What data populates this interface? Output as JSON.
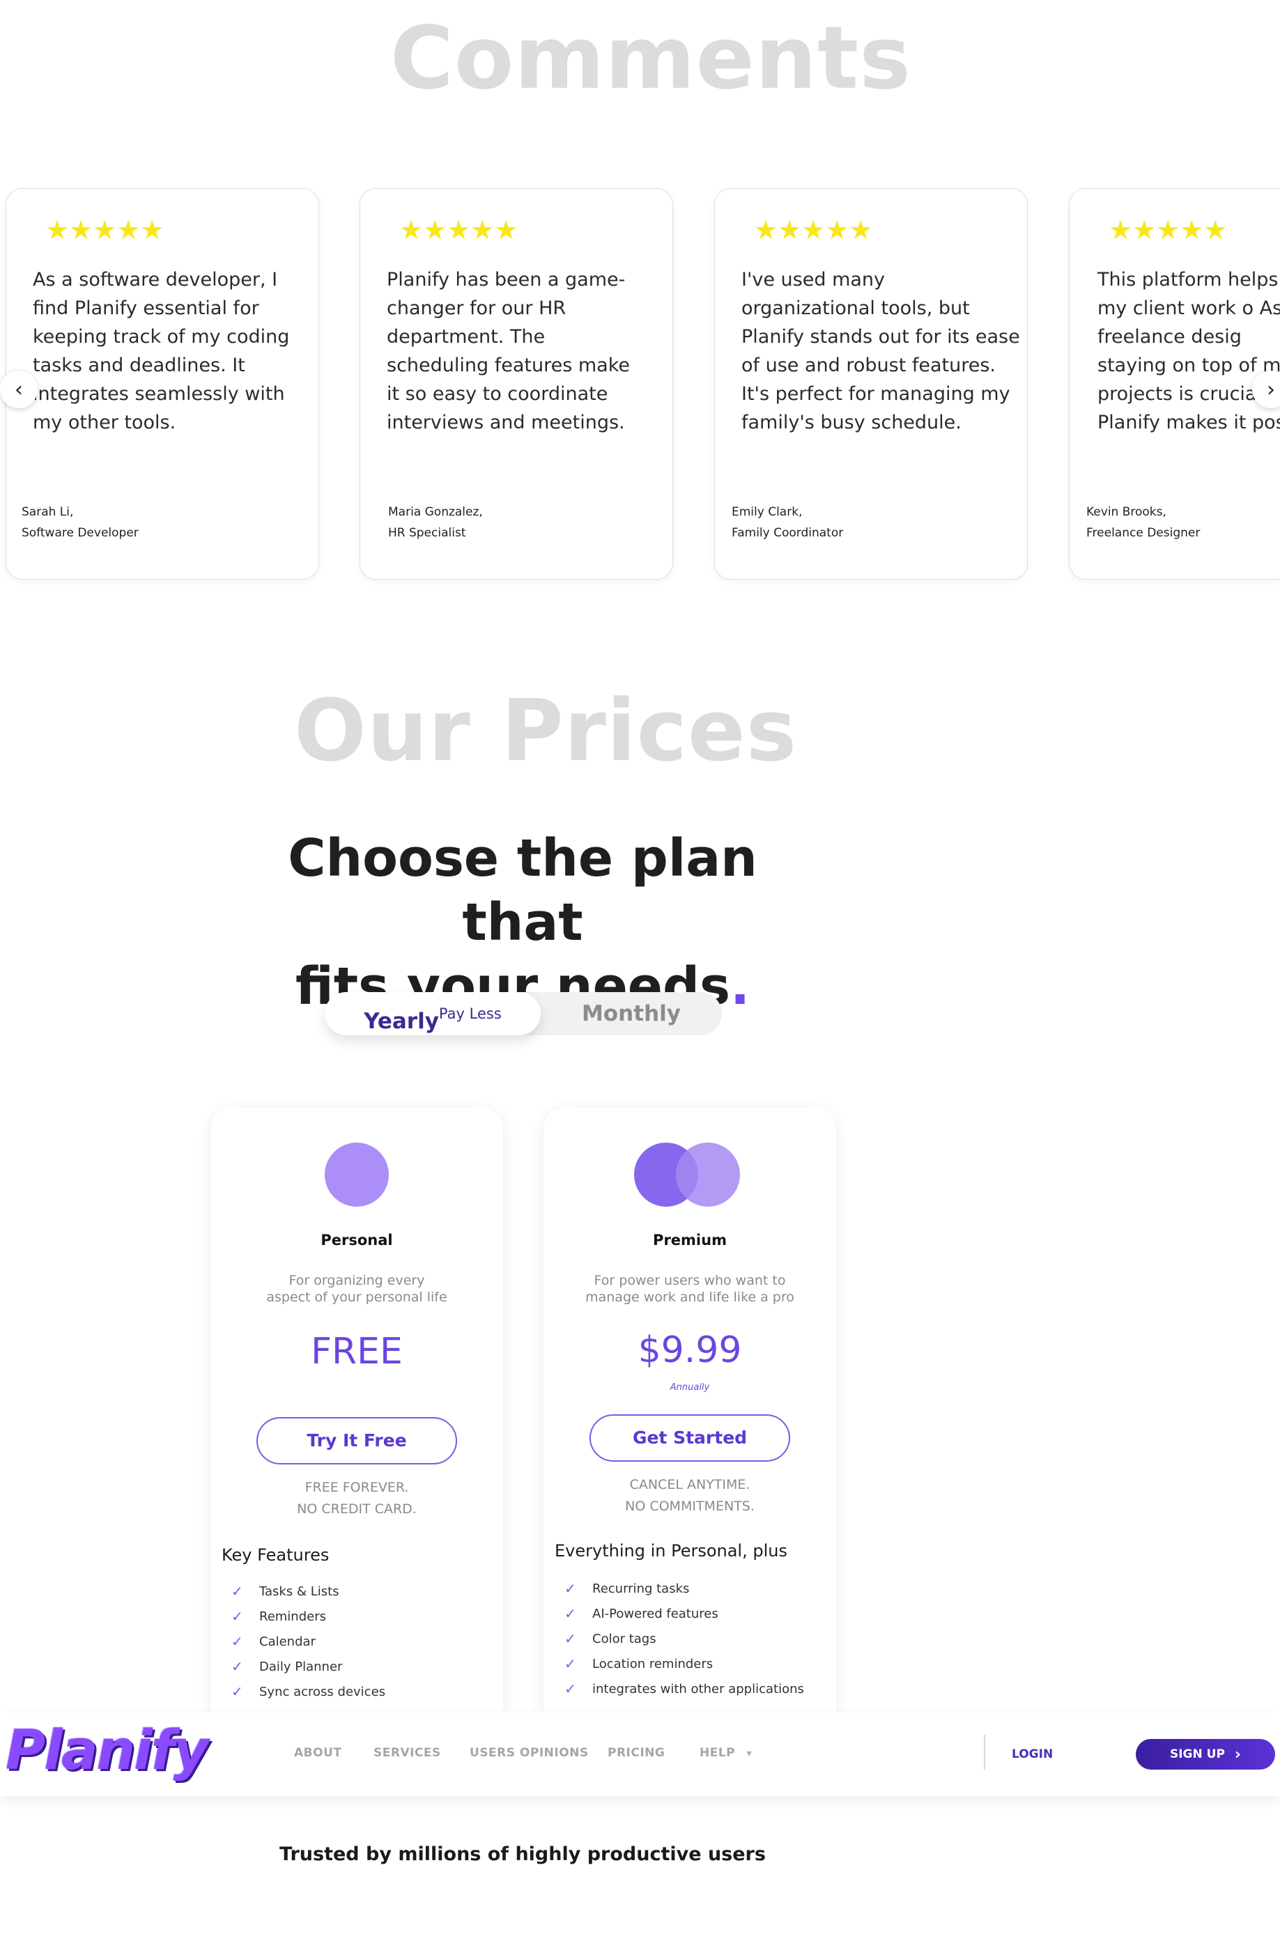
{
  "sections": {
    "comments_title": "Comments",
    "prices_title": "Our Prices"
  },
  "testimonials": [
    {
      "stars": "★★★★★",
      "quote": "As a software developer, I find Planify essential for keeping track of my coding tasks and deadlines. It integrates seamlessly with my other tools.",
      "name": "Sarah Li,",
      "role": "Software Developer"
    },
    {
      "stars": "★★★★★",
      "quote": "Planify has been a game-changer for our HR department. The scheduling features make it so easy to coordinate interviews and meetings.",
      "name": "Maria Gonzalez,",
      "role": "HR Specialist"
    },
    {
      "stars": "★★★★★",
      "quote": "I've used many organizational tools, but Planify stands out for its ease of use and robust features. It's perfect for managing my family's busy schedule.",
      "name": "Emily Clark,",
      "role": "Family Coordinator"
    },
    {
      "stars": "★★★★★",
      "quote": "This platform helps all my client work o As a freelance desig staying on top of m projects is crucia Planify makes it pos",
      "name": "Kevin Brooks,",
      "role": "Freelance Designer"
    }
  ],
  "carousel": {
    "prev_icon": "‹",
    "next_icon": "›"
  },
  "pricing": {
    "heading_line1": "Choose the plan that",
    "heading_line2": "fits your needs",
    "heading_dot": ".",
    "toggle": {
      "yearly": "Yearly",
      "yearly_badge": "Pay Less",
      "monthly": "Monthly",
      "selected": "Yearly"
    },
    "plans": [
      {
        "name": "Personal",
        "desc_line1": "For organizing every",
        "desc_line2": "aspect of your personal life",
        "price": "FREE",
        "period": "",
        "button": "Try It Free",
        "note_line1": "FREE FOREVER.",
        "note_line2": "NO CREDIT CARD.",
        "features_title": "Key Features",
        "features": [
          "Tasks & Lists",
          "Reminders",
          "Calendar",
          "Daily Planner",
          "Sync across devices"
        ]
      },
      {
        "name": "Premium",
        "desc_line1": "For power users who want to",
        "desc_line2": "manage work and life like a pro",
        "price": "$9.99",
        "period": "Annually",
        "button": "Get Started",
        "note_line1": "CANCEL ANYTIME.",
        "note_line2": "NO COMMITMENTS.",
        "features_title": "Everything in Personal, plus",
        "features": [
          "Recurring tasks",
          "AI-Powered features",
          "Color tags",
          "Location reminders",
          "integrates with other applications"
        ]
      }
    ],
    "check_icon": "✓"
  },
  "navbar": {
    "brand": "Planify",
    "links": [
      "ABOUT",
      "SERVICES",
      "USERS OPINIONS",
      "PRICING",
      "HELP"
    ],
    "help_caret": "▾",
    "login": "LOGIN",
    "signup": "SIGN UP",
    "signup_icon": "›"
  },
  "trusted_text": "Trusted by millions of highly productive users",
  "colors": {
    "accent": "#6a46e0",
    "star": "#f7e81b",
    "section_title": "#dcdcdc",
    "signup_bg": "#4a2fb0"
  }
}
